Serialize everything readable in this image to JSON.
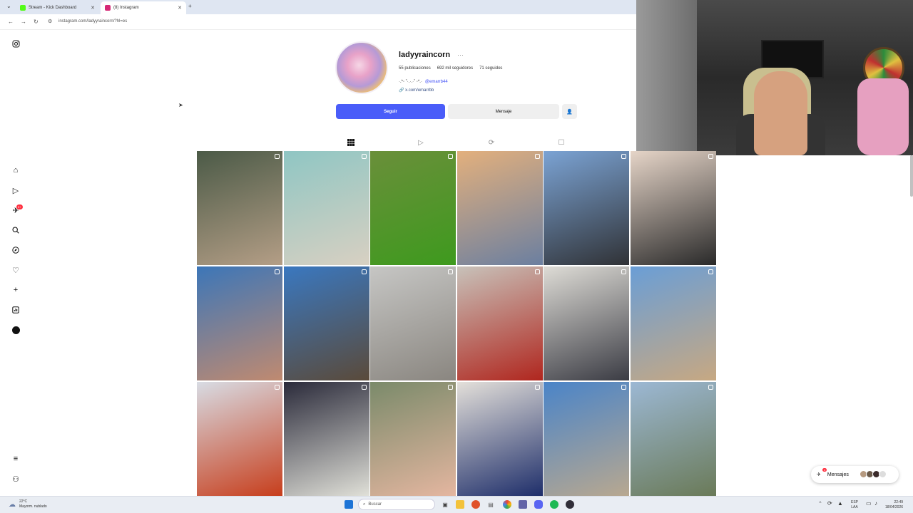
{
  "browser": {
    "tabs": [
      {
        "title": "Stream - Kick Dashboard",
        "favicon_color": "#53fc18"
      },
      {
        "title": "(8) Instagram",
        "favicon_color": "#d62976"
      }
    ],
    "url": "instagram.com/ladyyraincorn/?hl=es"
  },
  "profile": {
    "username": "ladyyraincorn",
    "more_glyph": "···",
    "stats": {
      "posts": "55 publicaciones",
      "followers": "692 mil seguidores",
      "following": "71 seguidos"
    },
    "bio_symbols": "·.*◦ ˚·.·.·˚ ◦*.·",
    "bio_mention": "@emarrb44",
    "link": "x.com/emarrbb",
    "follow_label": "Seguir",
    "message_label": "Mensaje",
    "notif_badge": "9+"
  },
  "posts": [
    {
      "c1": "#4b5a47",
      "c2": "#b49e86"
    },
    {
      "c1": "#8fc6c3",
      "c2": "#d8d0c2"
    },
    {
      "c1": "#6a8f3a",
      "c2": "#3e9a1e"
    },
    {
      "c1": "#e3b07d",
      "c2": "#6b7fa0"
    },
    {
      "c1": "#7ba3d4",
      "c2": "#303236"
    },
    {
      "c1": "#e6d5c8",
      "c2": "#2a2a2a"
    },
    {
      "c1": "#3c76b8",
      "c2": "#c08a70"
    },
    {
      "c1": "#3a78c0",
      "c2": "#5a4a3a"
    },
    {
      "c1": "#c6c6c4",
      "c2": "#8a8680"
    },
    {
      "c1": "#c8c2ba",
      "c2": "#b0261e"
    },
    {
      "c1": "#dedcd6",
      "c2": "#3b3c44"
    },
    {
      "c1": "#6a9ed6",
      "c2": "#c7a882"
    },
    {
      "c1": "#d8dce4",
      "c2": "#c73e1c"
    },
    {
      "c1": "#2a2a3a",
      "c2": "#e0e0d8"
    },
    {
      "c1": "#7a8a6a",
      "c2": "#e4b6a0"
    },
    {
      "c1": "#e4e0da",
      "c2": "#1e2e6a"
    },
    {
      "c1": "#4a84c8",
      "c2": "#b8a890"
    },
    {
      "c1": "#9cb8d4",
      "c2": "#6a7a58"
    }
  ],
  "dm": {
    "label": "Mensajes",
    "badge": "4"
  },
  "taskbar": {
    "temp": "22°C",
    "weather": "Mayorm. nublado",
    "search_placeholder": "Buscar",
    "lang_top": "ESP",
    "lang_bottom": "LAA",
    "time": "22:49",
    "date": "18/04/2026"
  }
}
